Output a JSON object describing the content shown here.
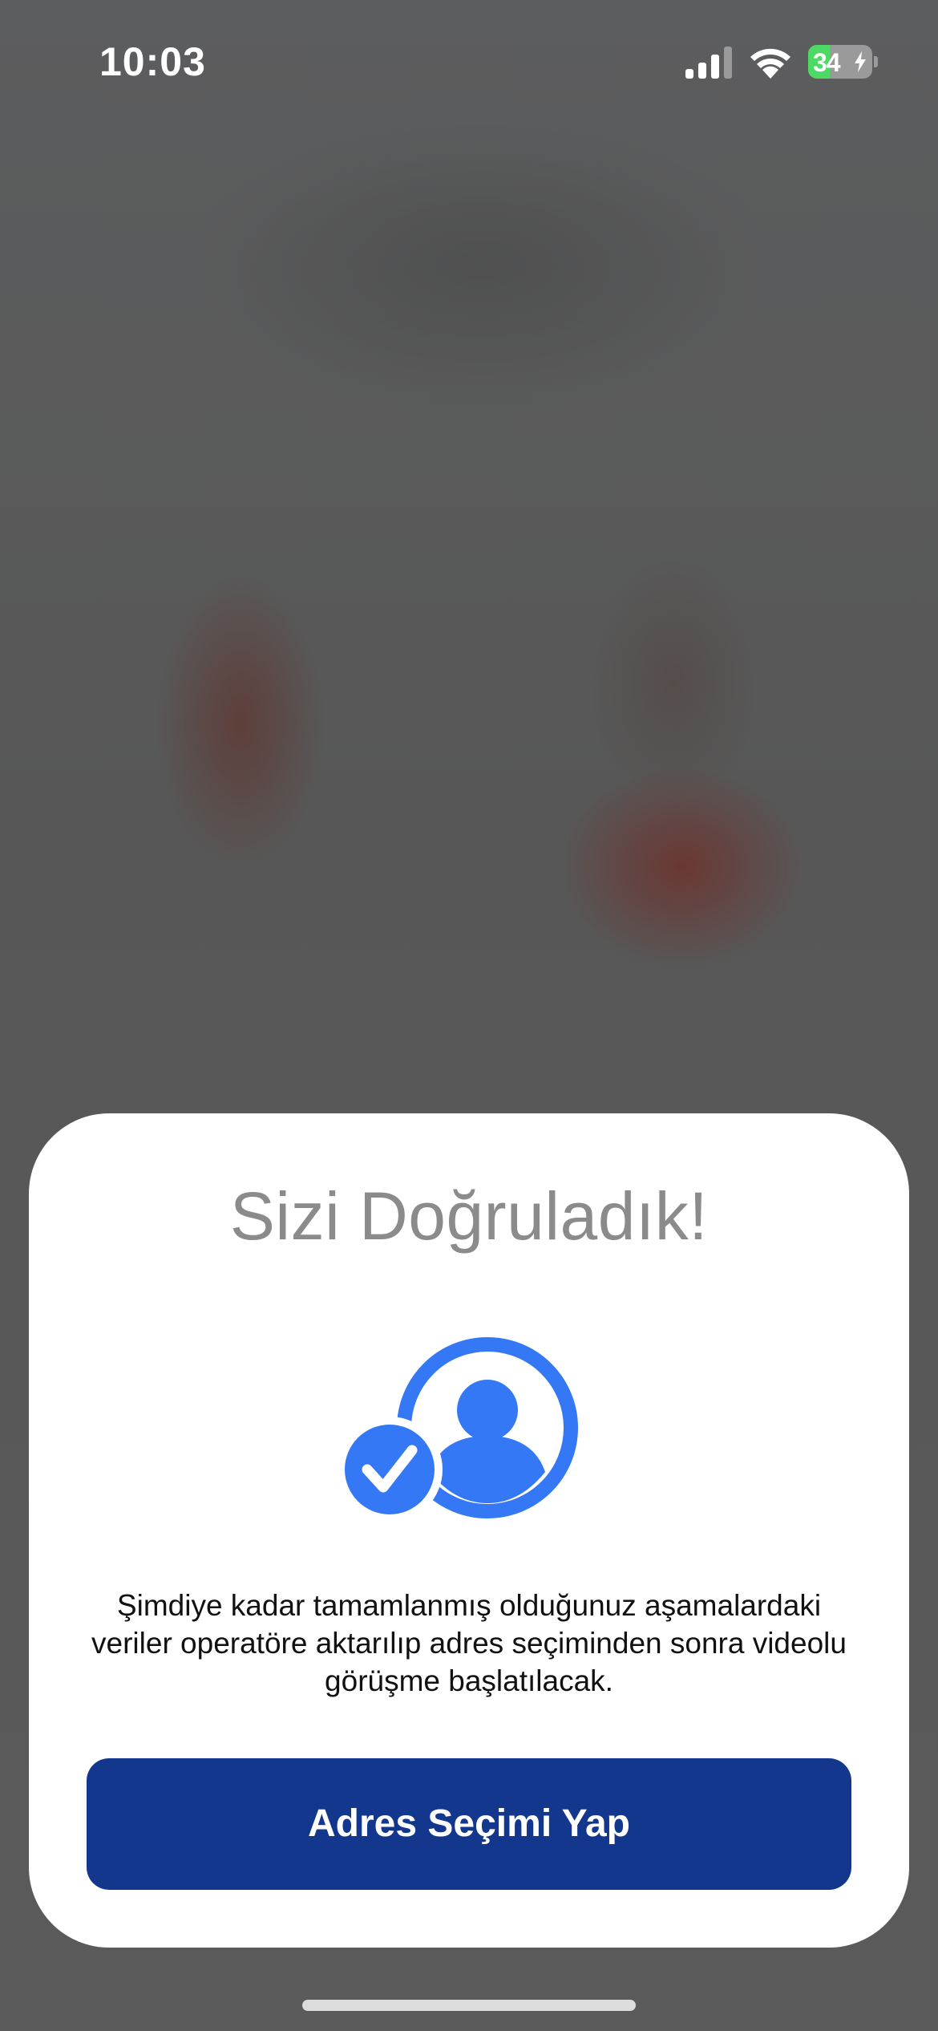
{
  "status_bar": {
    "time": "10:03",
    "battery_level": "34",
    "battery_charging": true,
    "battery_color": "#4cd964"
  },
  "icons": {
    "signal": "cellular-signal-icon",
    "wifi": "wifi-icon",
    "verified": "user-verified-icon"
  },
  "sheet": {
    "title": "Sizi Doğruladık!",
    "description": "Şimdiye kadar tamamlanmış olduğunuz aşamalardaki veriler operatöre aktarılıp adres seçiminden sonra videolu görüşme başlatılacak.",
    "button_label": "Adres Seçimi Yap"
  },
  "colors": {
    "accent_icon": "#3478f6",
    "button_background": "#14378e",
    "title_text": "#8b8b8b"
  }
}
